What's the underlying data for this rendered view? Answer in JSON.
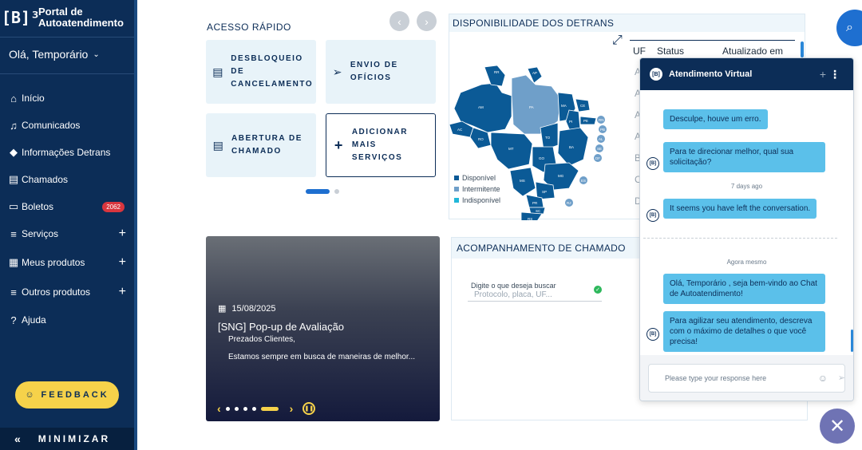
{
  "sidebar": {
    "brand_logo": "[B]³",
    "brand_line1": "Portal de",
    "brand_line2": "Autoatendimento",
    "user_greeting": "Olá, Temporário",
    "items": [
      {
        "label": "Início"
      },
      {
        "label": "Comunicados"
      },
      {
        "label": "Informações Detrans"
      },
      {
        "label": "Chamados"
      },
      {
        "label": "Boletos",
        "badge": "2062"
      },
      {
        "label": "Serviços"
      },
      {
        "label": "Meus produtos"
      },
      {
        "label": "Outros produtos"
      },
      {
        "label": "Ajuda"
      }
    ],
    "feedback_label": "FEEDBACK",
    "minimize_label": "MINIMIZAR"
  },
  "quick_access": {
    "title": "ACESSO RÁPIDO",
    "cards": [
      {
        "line1": "DESBLOQUEIO DE",
        "line2": "CANCELAMENTO"
      },
      {
        "line1": "ENVIO DE OFÍCIOS",
        "line2": ""
      },
      {
        "line1": "ABERTURA DE",
        "line2": "CHAMADO"
      },
      {
        "line1": "ADICIONAR MAIS",
        "line2": "SERVIÇOS"
      }
    ]
  },
  "availability": {
    "title": "DISPONIBILIDADE DOS DETRANS",
    "legend": [
      {
        "label": "Disponível",
        "color": "#0b5a96"
      },
      {
        "label": "Intermitente",
        "color": "#6f9fc9"
      },
      {
        "label": "Indisponível",
        "color": "#22b7d9"
      }
    ],
    "columns": [
      "UF",
      "Status",
      "Atualizado em"
    ],
    "row_initials": [
      "A",
      "A",
      "A",
      "A",
      "B",
      "C",
      "D"
    ],
    "states": [
      "RR",
      "AP",
      "AM",
      "PA",
      "MA",
      "CE",
      "RN",
      "PB",
      "PE",
      "AL",
      "SE",
      "AC",
      "RO",
      "TO",
      "PI",
      "BA",
      "MT",
      "GO",
      "DF",
      "MG",
      "ES",
      "MS",
      "SP",
      "RJ",
      "PR",
      "SC",
      "RS"
    ]
  },
  "carousel": {
    "date": "15/08/2025",
    "title": "[SNG] Pop-up de Avaliação",
    "subtitle": "Prezados Clientes,",
    "text": "Estamos sempre em busca de maneiras de melhor..."
  },
  "tracking": {
    "title": "ACOMPANHAMENTO DE CHAMADO",
    "label": "Digite o que deseja buscar",
    "placeholder": "Protocolo, placa, UF..."
  },
  "chat": {
    "title": "Atendimento Virtual",
    "bot_avatar": "[B]",
    "messages": [
      {
        "text": "Desculpe, houve um erro."
      },
      {
        "text": "Para te direcionar melhor, qual sua solicitação?"
      },
      {
        "text": "It seems you have left the conversation."
      },
      {
        "text": "Olá, Temporário , seja bem-vindo ao Chat de Autoatendimento!"
      },
      {
        "text": "Para agilizar seu atendimento, descreva com o máximo de detalhes o que você precisa!"
      }
    ],
    "time_1": "7 days ago",
    "time_2": "Agora mesmo",
    "input_placeholder": "Please type your response here"
  }
}
